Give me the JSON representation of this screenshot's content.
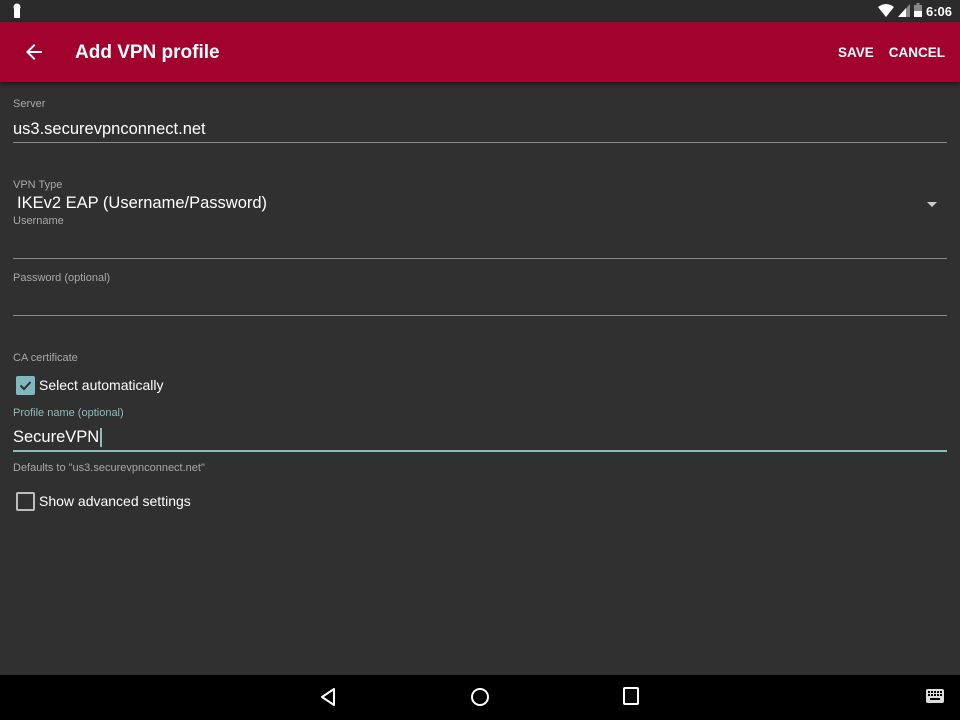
{
  "status_bar": {
    "time": "6:06",
    "icons": [
      "notification-icon",
      "wifi-icon",
      "signal-icon",
      "battery-icon"
    ]
  },
  "app_bar": {
    "title": "Add VPN profile",
    "back_icon": "arrow-left-icon",
    "save_label": "SAVE",
    "cancel_label": "CANCEL"
  },
  "form": {
    "server": {
      "label": "Server",
      "value": "us3.securevpnconnect.net"
    },
    "vpn_type": {
      "label": "VPN Type",
      "value": "IKEv2 EAP (Username/Password)"
    },
    "username": {
      "label": "Username",
      "value": ""
    },
    "password": {
      "label": "Password (optional)",
      "value": ""
    },
    "ca_certificate": {
      "label": "CA certificate",
      "select_automatically_label": "Select automatically",
      "select_automatically_checked": true
    },
    "profile_name": {
      "label": "Profile name (optional)",
      "value": "SecureVPN",
      "helper": "Defaults to \"us3.securevpnconnect.net\""
    },
    "advanced": {
      "label": "Show advanced settings",
      "checked": false
    }
  },
  "nav_bar": {
    "buttons": [
      "back-icon",
      "home-icon",
      "recents-icon",
      "keyboard-icon"
    ]
  }
}
